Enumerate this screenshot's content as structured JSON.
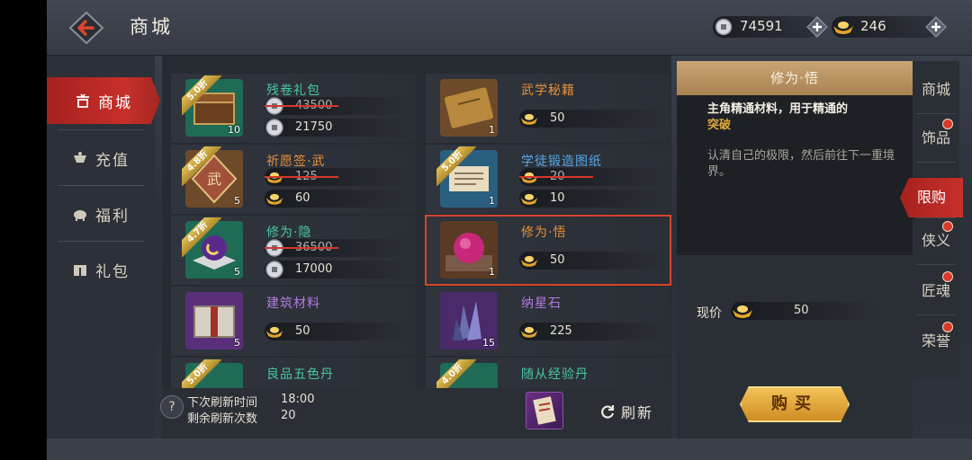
{
  "header": {
    "title": "商城",
    "silver": "74591",
    "gold": "246"
  },
  "left_menu": [
    {
      "label": "商城",
      "active": true
    },
    {
      "label": "充值"
    },
    {
      "label": "福利"
    },
    {
      "label": "礼包"
    }
  ],
  "items": [
    {
      "name": "残卷礼包",
      "name_color": "#47c9a3",
      "discount": "5.0折",
      "count": "10",
      "old_price": "43500",
      "price": "21750",
      "currency": "silver",
      "thumb": "green-chest"
    },
    {
      "name": "武学秘籍",
      "name_color": "#e88f3b",
      "discount": "",
      "count": "1",
      "old_price": "",
      "price": "50",
      "currency": "gold",
      "thumb": "book"
    },
    {
      "name": "祈愿签·武",
      "name_color": "#e88f3b",
      "discount": "4.8折",
      "count": "5",
      "old_price": "125",
      "price": "60",
      "currency": "gold",
      "thumb": "token"
    },
    {
      "name": "学徒锻造图纸",
      "name_color": "#58a8e6",
      "discount": "5.0折",
      "count": "1",
      "old_price": "20",
      "price": "10",
      "currency": "gold",
      "thumb": "scroll"
    },
    {
      "name": "修为·隐",
      "name_color": "#47c9a3",
      "discount": "4.7折",
      "count": "5",
      "old_price": "36500",
      "price": "17000",
      "currency": "silver",
      "thumb": "orb-green"
    },
    {
      "name": "修为·悟",
      "name_color": "#e88f3b",
      "discount": "",
      "count": "1",
      "old_price": "",
      "price": "50",
      "currency": "gold",
      "thumb": "orb-purple",
      "selected": true
    },
    {
      "name": "建筑材料",
      "name_color": "#b37ae0",
      "discount": "",
      "count": "5",
      "old_price": "",
      "price": "50",
      "currency": "gold",
      "thumb": "crate"
    },
    {
      "name": "纳星石",
      "name_color": "#b37ae0",
      "discount": "",
      "count": "15",
      "old_price": "",
      "price": "225",
      "currency": "gold",
      "thumb": "crystal"
    },
    {
      "name": "良品五色丹",
      "name_color": "#47c9a3",
      "discount": "5.0折",
      "count": "",
      "old_price": "",
      "price": "",
      "currency": "silver",
      "thumb": "green"
    },
    {
      "name": "随从经验丹",
      "name_color": "#47c9a3",
      "discount": "4.0折",
      "count": "",
      "old_price": "",
      "price": "",
      "currency": "silver",
      "thumb": "blue-green"
    }
  ],
  "refresh": {
    "next_label": "下次刷新时间",
    "next_time": "18:00",
    "remaining_label": "剩余刷新次数",
    "remaining": "20",
    "button": "刷新"
  },
  "detail": {
    "title": "修为·悟",
    "desc_main": "主角精通材料，用于精通的",
    "desc_highlight": "突破",
    "desc_flavor": "认清自己的极限，然后前往下一重境界。",
    "price_label": "现价",
    "price": "50",
    "buy": "购买"
  },
  "right_tabs": [
    {
      "label": "商城",
      "dot": false
    },
    {
      "label": "饰品",
      "dot": true
    },
    {
      "label": "限购",
      "dot": false,
      "active": true
    },
    {
      "label": "侠义",
      "dot": true
    },
    {
      "label": "匠魂",
      "dot": true
    },
    {
      "label": "荣誉",
      "dot": true
    }
  ],
  "colors": {
    "accent_red": "#c7302a",
    "gold": "#e2a73a",
    "selected_outline": "#d7442c"
  }
}
